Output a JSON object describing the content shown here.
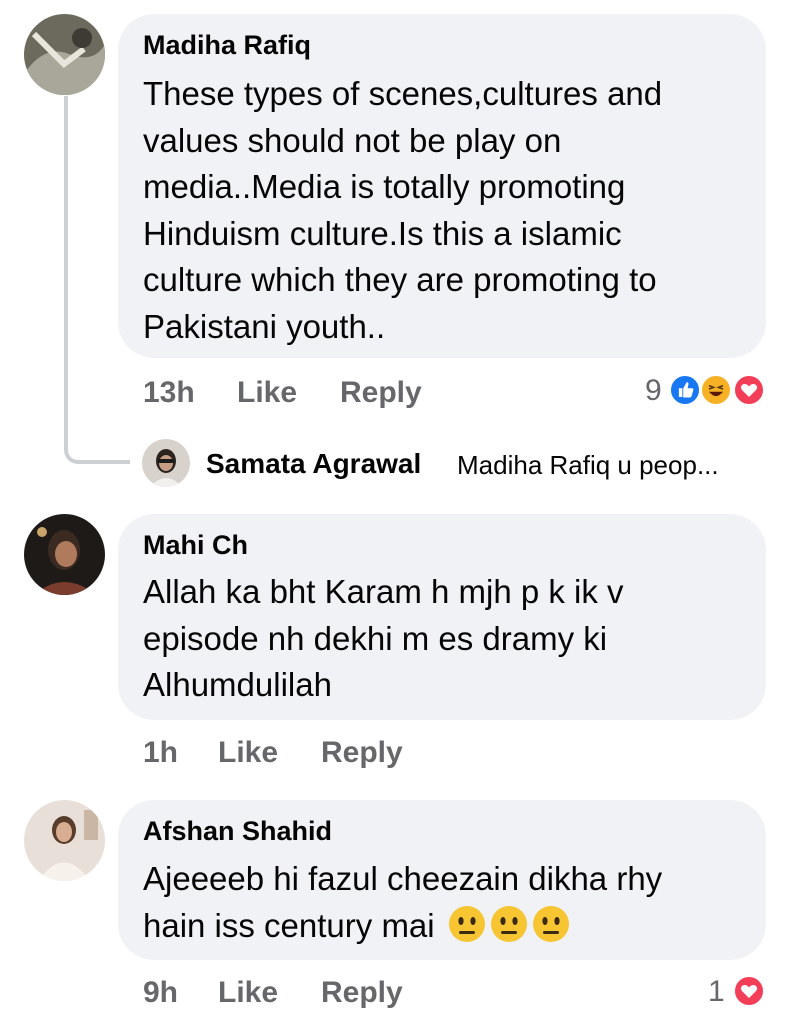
{
  "comments": [
    {
      "author": "Madiha Rafiq",
      "lines": [
        "These types of scenes,cultures and",
        "values should not be play on",
        "media..Media is totally promoting",
        "Hinduism culture.Is this a islamic",
        "culture which they are promoting to",
        "Pakistani youth.."
      ],
      "time": "13h",
      "like_label": "Like",
      "reply_label": "Reply",
      "reaction_count": "9",
      "reactions": [
        "like-icon",
        "haha-icon",
        "love-icon"
      ],
      "reply_preview": {
        "author": "Samata Agrawal",
        "snippet": "Madiha Rafiq  u peop..."
      }
    },
    {
      "author": "Mahi Ch",
      "lines": [
        "Allah ka bht Karam h mjh p k ik v",
        "episode nh dekhi m es dramy ki",
        "Alhumdulilah"
      ],
      "time": "1h",
      "like_label": "Like",
      "reply_label": "Reply"
    },
    {
      "author": "Afshan Shahid",
      "lines": [
        "Ajeeeeb hi fazul cheezain dikha rhy",
        "hain iss century mai"
      ],
      "emoji": [
        "neutral-face-icon",
        "neutral-face-icon",
        "neutral-face-icon"
      ],
      "time": "9h",
      "like_label": "Like",
      "reply_label": "Reply",
      "reaction_count": "1",
      "reactions": [
        "love-icon"
      ]
    }
  ],
  "colors": {
    "bubble": "#f0f2f5",
    "meta_text": "#65676b",
    "like_blue": "#1877f2",
    "love_red": "#f33e58",
    "haha_yellow": "#f7b125"
  }
}
